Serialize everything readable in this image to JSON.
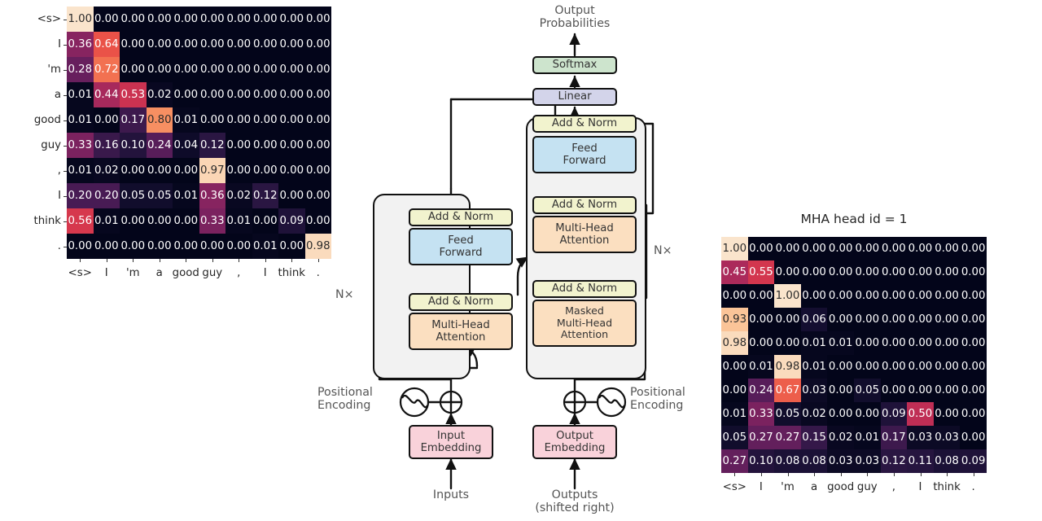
{
  "tokens": [
    "<s>",
    "I",
    "'m",
    "a",
    "good",
    "guy",
    ",",
    "I",
    "think",
    "."
  ],
  "heatmaps": [
    {
      "name": "left-attention-heatmap",
      "title": "",
      "show_ylabels": true,
      "values": [
        [
          1.0,
          0.0,
          0.0,
          0.0,
          0.0,
          0.0,
          0.0,
          0.0,
          0.0,
          0.0
        ],
        [
          0.36,
          0.64,
          0.0,
          0.0,
          0.0,
          0.0,
          0.0,
          0.0,
          0.0,
          0.0
        ],
        [
          0.28,
          0.72,
          0.0,
          0.0,
          0.0,
          0.0,
          0.0,
          0.0,
          0.0,
          0.0
        ],
        [
          0.01,
          0.44,
          0.53,
          0.02,
          0.0,
          0.0,
          0.0,
          0.0,
          0.0,
          0.0
        ],
        [
          0.01,
          0.0,
          0.17,
          0.8,
          0.01,
          0.0,
          0.0,
          0.0,
          0.0,
          0.0
        ],
        [
          0.33,
          0.16,
          0.1,
          0.24,
          0.04,
          0.12,
          0.0,
          0.0,
          0.0,
          0.0
        ],
        [
          0.01,
          0.02,
          0.0,
          0.0,
          0.0,
          0.97,
          0.0,
          0.0,
          0.0,
          0.0
        ],
        [
          0.2,
          0.2,
          0.05,
          0.05,
          0.01,
          0.36,
          0.02,
          0.12,
          0.0,
          0.0
        ],
        [
          0.56,
          0.01,
          0.0,
          0.0,
          0.0,
          0.33,
          0.01,
          0.0,
          0.09,
          0.0
        ],
        [
          0.0,
          0.0,
          0.0,
          0.0,
          0.0,
          0.0,
          0.0,
          0.01,
          0.0,
          0.98
        ]
      ]
    },
    {
      "name": "right-attention-heatmap",
      "title": "MHA head id = 1",
      "show_ylabels": false,
      "values": [
        [
          1.0,
          0.0,
          0.0,
          0.0,
          0.0,
          0.0,
          0.0,
          0.0,
          0.0,
          0.0
        ],
        [
          0.45,
          0.55,
          0.0,
          0.0,
          0.0,
          0.0,
          0.0,
          0.0,
          0.0,
          0.0
        ],
        [
          0.0,
          0.0,
          1.0,
          0.0,
          0.0,
          0.0,
          0.0,
          0.0,
          0.0,
          0.0
        ],
        [
          0.93,
          0.0,
          0.0,
          0.06,
          0.0,
          0.0,
          0.0,
          0.0,
          0.0,
          0.0
        ],
        [
          0.98,
          0.0,
          0.0,
          0.01,
          0.01,
          0.0,
          0.0,
          0.0,
          0.0,
          0.0
        ],
        [
          0.0,
          0.01,
          0.98,
          0.01,
          0.0,
          0.0,
          0.0,
          0.0,
          0.0,
          0.0
        ],
        [
          0.0,
          0.24,
          0.67,
          0.03,
          0.0,
          0.05,
          0.0,
          0.0,
          0.0,
          0.0
        ],
        [
          0.01,
          0.33,
          0.05,
          0.02,
          0.0,
          0.0,
          0.09,
          0.5,
          0.0,
          0.0
        ],
        [
          0.05,
          0.27,
          0.27,
          0.15,
          0.02,
          0.01,
          0.17,
          0.03,
          0.03,
          0.0
        ],
        [
          0.27,
          0.1,
          0.08,
          0.08,
          0.03,
          0.03,
          0.12,
          0.11,
          0.08,
          0.09
        ]
      ]
    }
  ],
  "diagram": {
    "output_probabilities": "Output\nProbabilities",
    "softmax": "Softmax",
    "linear": "Linear",
    "add_norm": "Add & Norm",
    "feed_forward": "Feed\nForward",
    "multi_head_attention": "Multi-Head\nAttention",
    "masked_multi_head_attention": "Masked\nMulti-Head\nAttention",
    "nx_left": "N×",
    "nx_right": "N×",
    "positional_encoding_left": "Positional\nEncoding",
    "positional_encoding_right": "Positional\nEncoding",
    "input_embedding": "Input\nEmbedding",
    "output_embedding": "Output\nEmbedding",
    "inputs": "Inputs",
    "outputs": "Outputs\n(shifted right)"
  },
  "colors": {
    "add_norm_fill": "#f2f3ce",
    "feed_forward_fill": "#c5e2f2",
    "attention_fill": "#fbdfc0",
    "softmax_fill": "#cde4cd",
    "linear_fill": "#d3d4ea",
    "embedding_fill": "#f9d2da",
    "shell_fill": "#f2f2f2",
    "stroke": "#111111",
    "heatmap_bg": "#0b0718"
  }
}
